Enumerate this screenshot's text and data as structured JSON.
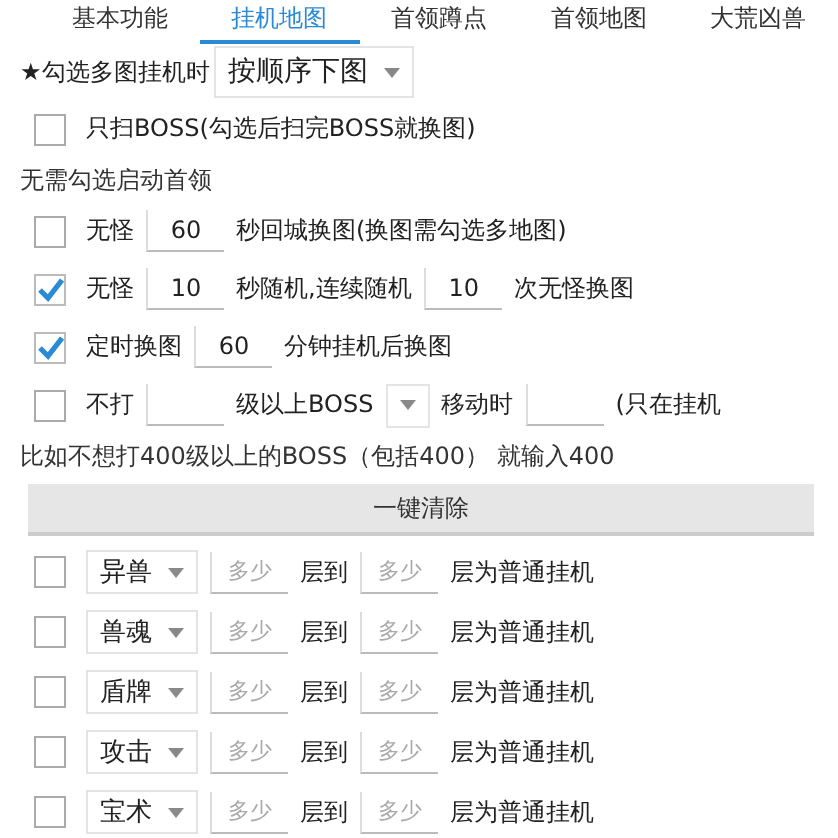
{
  "tabs": [
    {
      "label": "基本功能",
      "selected": false
    },
    {
      "label": "挂机地图",
      "selected": true
    },
    {
      "label": "首领蹲点",
      "selected": false
    },
    {
      "label": "首领地图",
      "selected": false
    },
    {
      "label": "大荒凶兽",
      "selected": false
    }
  ],
  "rows": [
    {
      "kind": "select",
      "parts": [
        {
          "kind": "text",
          "text": "★勾选多图挂机时"
        },
        {
          "kind": "select",
          "text": "按顺序下图"
        }
      ]
    },
    {
      "kind": "check",
      "checked": false,
      "parts": [
        {
          "kind": "text",
          "text": "只扫BOSS(勾选后扫完BOSS就换图)"
        }
      ]
    },
    {
      "kind": "label",
      "parts": [
        {
          "kind": "text",
          "text": "无需勾选启动首领"
        }
      ]
    },
    {
      "kind": "check",
      "checked": false,
      "parts": [
        {
          "kind": "text",
          "text": "无怪"
        },
        {
          "kind": "field",
          "value": "60"
        },
        {
          "kind": "text",
          "text": "秒回城换图(换图需勾选多地图)"
        }
      ]
    },
    {
      "kind": "check",
      "checked": true,
      "parts": [
        {
          "kind": "text",
          "text": "无怪"
        },
        {
          "kind": "field",
          "value": "10"
        },
        {
          "kind": "text",
          "text": "秒随机,连续随机"
        },
        {
          "kind": "field",
          "value": "10"
        },
        {
          "kind": "text",
          "text": "次无怪换图"
        }
      ]
    },
    {
      "kind": "check",
      "checked": true,
      "parts": [
        {
          "kind": "text",
          "text": "定时换图"
        },
        {
          "kind": "field",
          "value": "60"
        },
        {
          "kind": "text",
          "text": "分钟挂机后换图"
        }
      ]
    },
    {
      "kind": "check",
      "checked": false,
      "parts": [
        {
          "kind": "text",
          "text": "不打"
        },
        {
          "kind": "field"
        },
        {
          "kind": "text",
          "text": "级以上BOSS"
        },
        {
          "kind": "select"
        },
        {
          "kind": "text",
          "text": "移动时"
        },
        {
          "kind": "field"
        },
        {
          "kind": "text",
          "text": "(只在挂机"
        }
      ]
    },
    {
      "kind": "label",
      "parts": [
        {
          "kind": "text",
          "text": "比如不想打400级以上的BOSS（包括400） 就输入400"
        }
      ]
    },
    {
      "kind": "button",
      "text": "一键清除"
    },
    {
      "kind": "check",
      "checked": false,
      "parts": [
        {
          "kind": "select",
          "text": "异兽"
        },
        {
          "kind": "field",
          "placeholder": "多少"
        },
        {
          "kind": "text",
          "text": "层到"
        },
        {
          "kind": "field",
          "placeholder": "多少"
        },
        {
          "kind": "text",
          "text": "层为普通挂机"
        }
      ]
    },
    {
      "kind": "check",
      "checked": false,
      "parts": [
        {
          "kind": "select",
          "text": "兽魂"
        },
        {
          "kind": "field",
          "placeholder": "多少"
        },
        {
          "kind": "text",
          "text": "层到"
        },
        {
          "kind": "field",
          "placeholder": "多少"
        },
        {
          "kind": "text",
          "text": "层为普通挂机"
        }
      ]
    },
    {
      "kind": "check",
      "checked": false,
      "parts": [
        {
          "kind": "select",
          "text": "盾牌"
        },
        {
          "kind": "field",
          "placeholder": "多少"
        },
        {
          "kind": "text",
          "text": "层到"
        },
        {
          "kind": "field",
          "placeholder": "多少"
        },
        {
          "kind": "text",
          "text": "层为普通挂机"
        }
      ]
    },
    {
      "kind": "check",
      "checked": false,
      "parts": [
        {
          "kind": "select",
          "text": "攻击"
        },
        {
          "kind": "field",
          "placeholder": "多少"
        },
        {
          "kind": "text",
          "text": "层到"
        },
        {
          "kind": "field",
          "placeholder": "多少"
        },
        {
          "kind": "text",
          "text": "层为普通挂机"
        }
      ]
    },
    {
      "kind": "check",
      "checked": false,
      "parts": [
        {
          "kind": "select",
          "text": "宝术"
        },
        {
          "kind": "field",
          "placeholder": "多少"
        },
        {
          "kind": "text",
          "text": "层到"
        },
        {
          "kind": "field",
          "placeholder": "多少"
        },
        {
          "kind": "text",
          "text": "层为普通挂机"
        }
      ]
    }
  ]
}
